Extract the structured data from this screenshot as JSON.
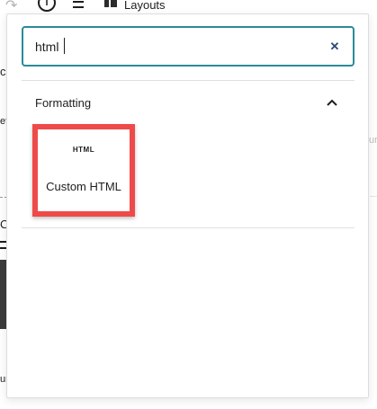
{
  "toolbar": {
    "layouts_label": "Layouts"
  },
  "background": {
    "frag_c1": "c",
    "frag_efa": "efa",
    "frag_c2": "C",
    "frag_ure": "ure",
    "frag_ur": "ur"
  },
  "inserter": {
    "search": {
      "value": "html",
      "clear_icon": "close-icon"
    },
    "panel": {
      "title": "Formatting",
      "expanded": true,
      "toggle_icon": "chevron-up-icon"
    },
    "blocks": [
      {
        "icon_text": "HTML",
        "label": "Custom HTML",
        "highlighted": true,
        "highlight_color": "#ef4a4a"
      }
    ]
  },
  "colors": {
    "search_border": "#2b8a99",
    "clear_icon": "#2a4a73",
    "highlight": "#ef4a4a"
  }
}
